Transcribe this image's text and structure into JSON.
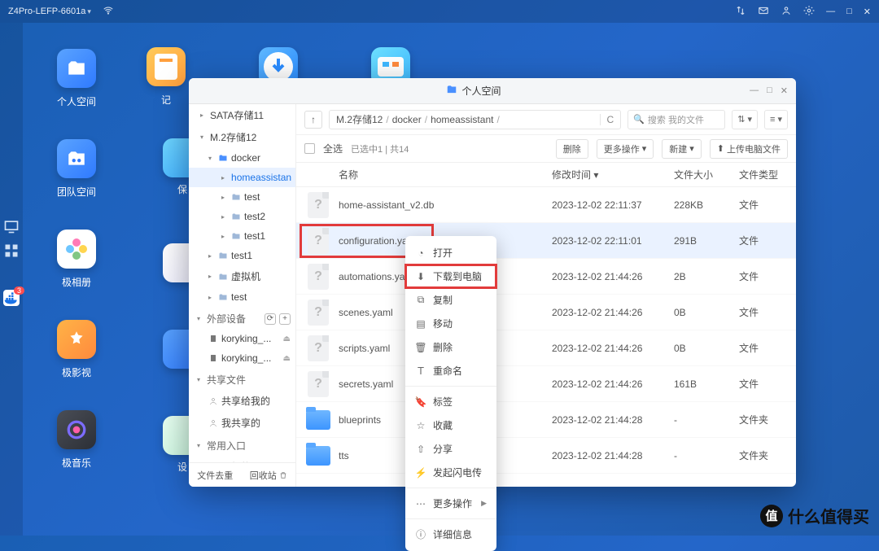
{
  "topbar": {
    "device": "Z4Pro-LEFP-6601a"
  },
  "desktop": {
    "icons": [
      {
        "label": "个人空间"
      },
      {
        "label": "团队空间"
      },
      {
        "label": "极相册"
      },
      {
        "label": "极影视"
      },
      {
        "label": "极音乐"
      }
    ]
  },
  "apprail": {
    "items": [
      {
        "label": "记"
      },
      {
        "label": ""
      },
      {
        "label": ""
      }
    ]
  },
  "dock_badge": "3",
  "filemanager": {
    "title": "个人空间",
    "sidebar": {
      "sata": "SATA存储11",
      "m2": "M.2存储12",
      "docker": "docker",
      "homeassistant": "homeassistan",
      "test": "test",
      "test2": "test2",
      "test1a": "test1",
      "test1b": "test1",
      "vm": "虚拟机",
      "testc": "test",
      "external": "外部设备",
      "ext1": "koryking_...",
      "ext2": "koryking_...",
      "shared": "共享文件",
      "shared_to_me": "共享给我的",
      "shared_by_me": "我共享的",
      "frequent": "常用入口",
      "recent": "最新的",
      "foot_dedup": "文件去重",
      "foot_trash": "回收站"
    },
    "breadcrumb": [
      "M.2存储12",
      "docker",
      "homeassistant"
    ],
    "search_placeholder": "搜索 我的文件",
    "tools": {
      "select_all": "全选",
      "status": "已选中1 | 共14",
      "delete": "删除",
      "more": "更多操作",
      "new": "新建",
      "upload": "上传电脑文件"
    },
    "columns": {
      "name": "名称",
      "mtime": "修改时间",
      "size": "文件大小",
      "type": "文件类型"
    },
    "rows": [
      {
        "name": "home-assistant_v2.db",
        "mtime": "2023-12-02 22:11:37",
        "size": "228KB",
        "type": "文件",
        "folder": false
      },
      {
        "name": "configuration.yaml",
        "mtime": "2023-12-02 22:11:01",
        "size": "291B",
        "type": "文件",
        "folder": false,
        "selected": true,
        "highlight": true
      },
      {
        "name": "automations.yaml",
        "mtime": "2023-12-02 21:44:26",
        "size": "2B",
        "type": "文件",
        "folder": false
      },
      {
        "name": "scenes.yaml",
        "mtime": "2023-12-02 21:44:26",
        "size": "0B",
        "type": "文件",
        "folder": false
      },
      {
        "name": "scripts.yaml",
        "mtime": "2023-12-02 21:44:26",
        "size": "0B",
        "type": "文件",
        "folder": false
      },
      {
        "name": "secrets.yaml",
        "mtime": "2023-12-02 21:44:26",
        "size": "161B",
        "type": "文件",
        "folder": false
      },
      {
        "name": "blueprints",
        "mtime": "2023-12-02 21:44:28",
        "size": "-",
        "type": "文件夹",
        "folder": true
      },
      {
        "name": "tts",
        "mtime": "2023-12-02 21:44:28",
        "size": "-",
        "type": "文件夹",
        "folder": true
      }
    ],
    "ctx": {
      "open": "打开",
      "download": "下载到电脑",
      "copy": "复制",
      "move": "移动",
      "delete": "删除",
      "rename": "重命名",
      "label": "标签",
      "fav": "收藏",
      "share": "分享",
      "flash": "发起闪电传",
      "more": "更多操作",
      "details": "详细信息"
    }
  },
  "watermark": {
    "char": "值",
    "text": "什么值得买"
  }
}
